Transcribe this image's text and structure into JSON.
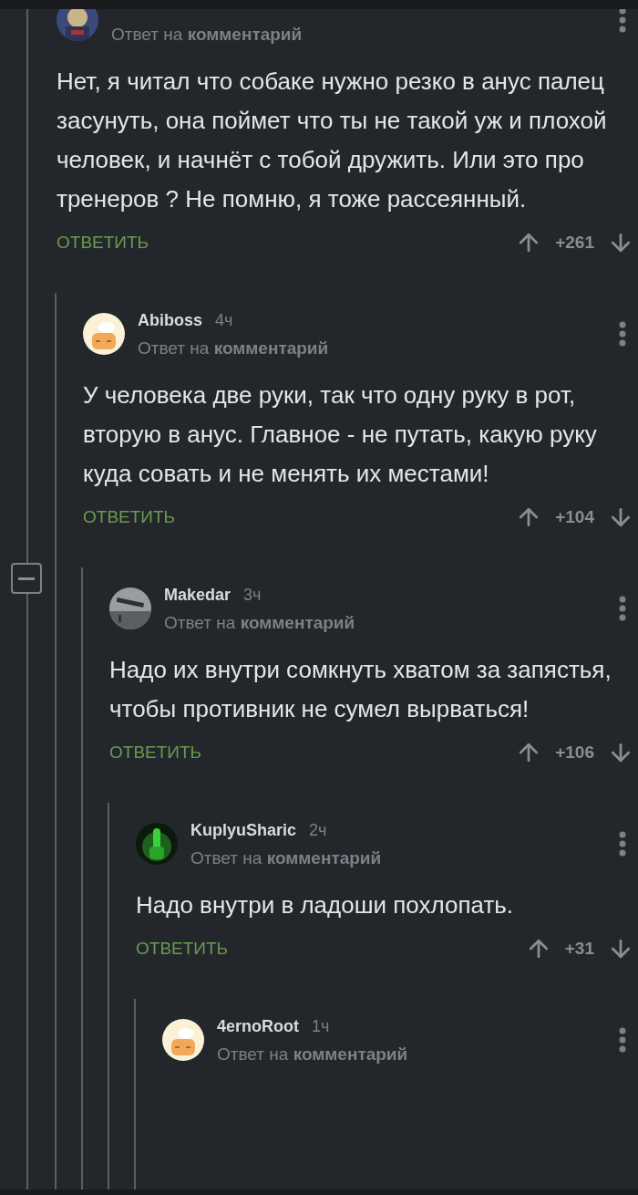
{
  "thread": {
    "comment": {
      "reply_to": "Ответ на **комментарий**",
      "text": "Нет, я читал что собаке нужно резко в анус палец засунуть, она поймет что ты не такой уж и плохой человек, и начнёт с тобой дружить. Или это про тренеров ? Не помню, я тоже рассеянный.",
      "reply_label": "ОТВЕТИТЬ",
      "score": "+261",
      "replies": [
        {
          "author": "Abiboss",
          "time": "4ч",
          "reply_to": "Ответ на **комментарий**",
          "text": "У человека две руки, так что одну руку в рот, вторую в анус. Главное - не путать, какую руку куда совать и не менять их местами!",
          "reply_label": "ОТВЕТИТЬ",
          "score": "+104",
          "replies": [
            {
              "author": "Makedar",
              "time": "3ч",
              "reply_to": "Ответ на **комментарий**",
              "text": "Надо их внутри сомкнуть хватом за запястья, чтобы противник не сумел вырваться!",
              "reply_label": "ОТВЕТИТЬ",
              "score": "+106",
              "replies": [
                {
                  "author": "KuplyuSharic",
                  "time": "2ч",
                  "reply_to": "Ответ на **комментарий**",
                  "text": "Надо внутри в ладоши похлопать.",
                  "reply_label": "ОТВЕТИТЬ",
                  "score": "+31",
                  "replies": [
                    {
                      "author": "4ernoRoot",
                      "time": "1ч",
                      "reply_to": "Ответ на **комментарий**"
                    }
                  ]
                }
              ]
            }
          ]
        }
      ]
    }
  }
}
